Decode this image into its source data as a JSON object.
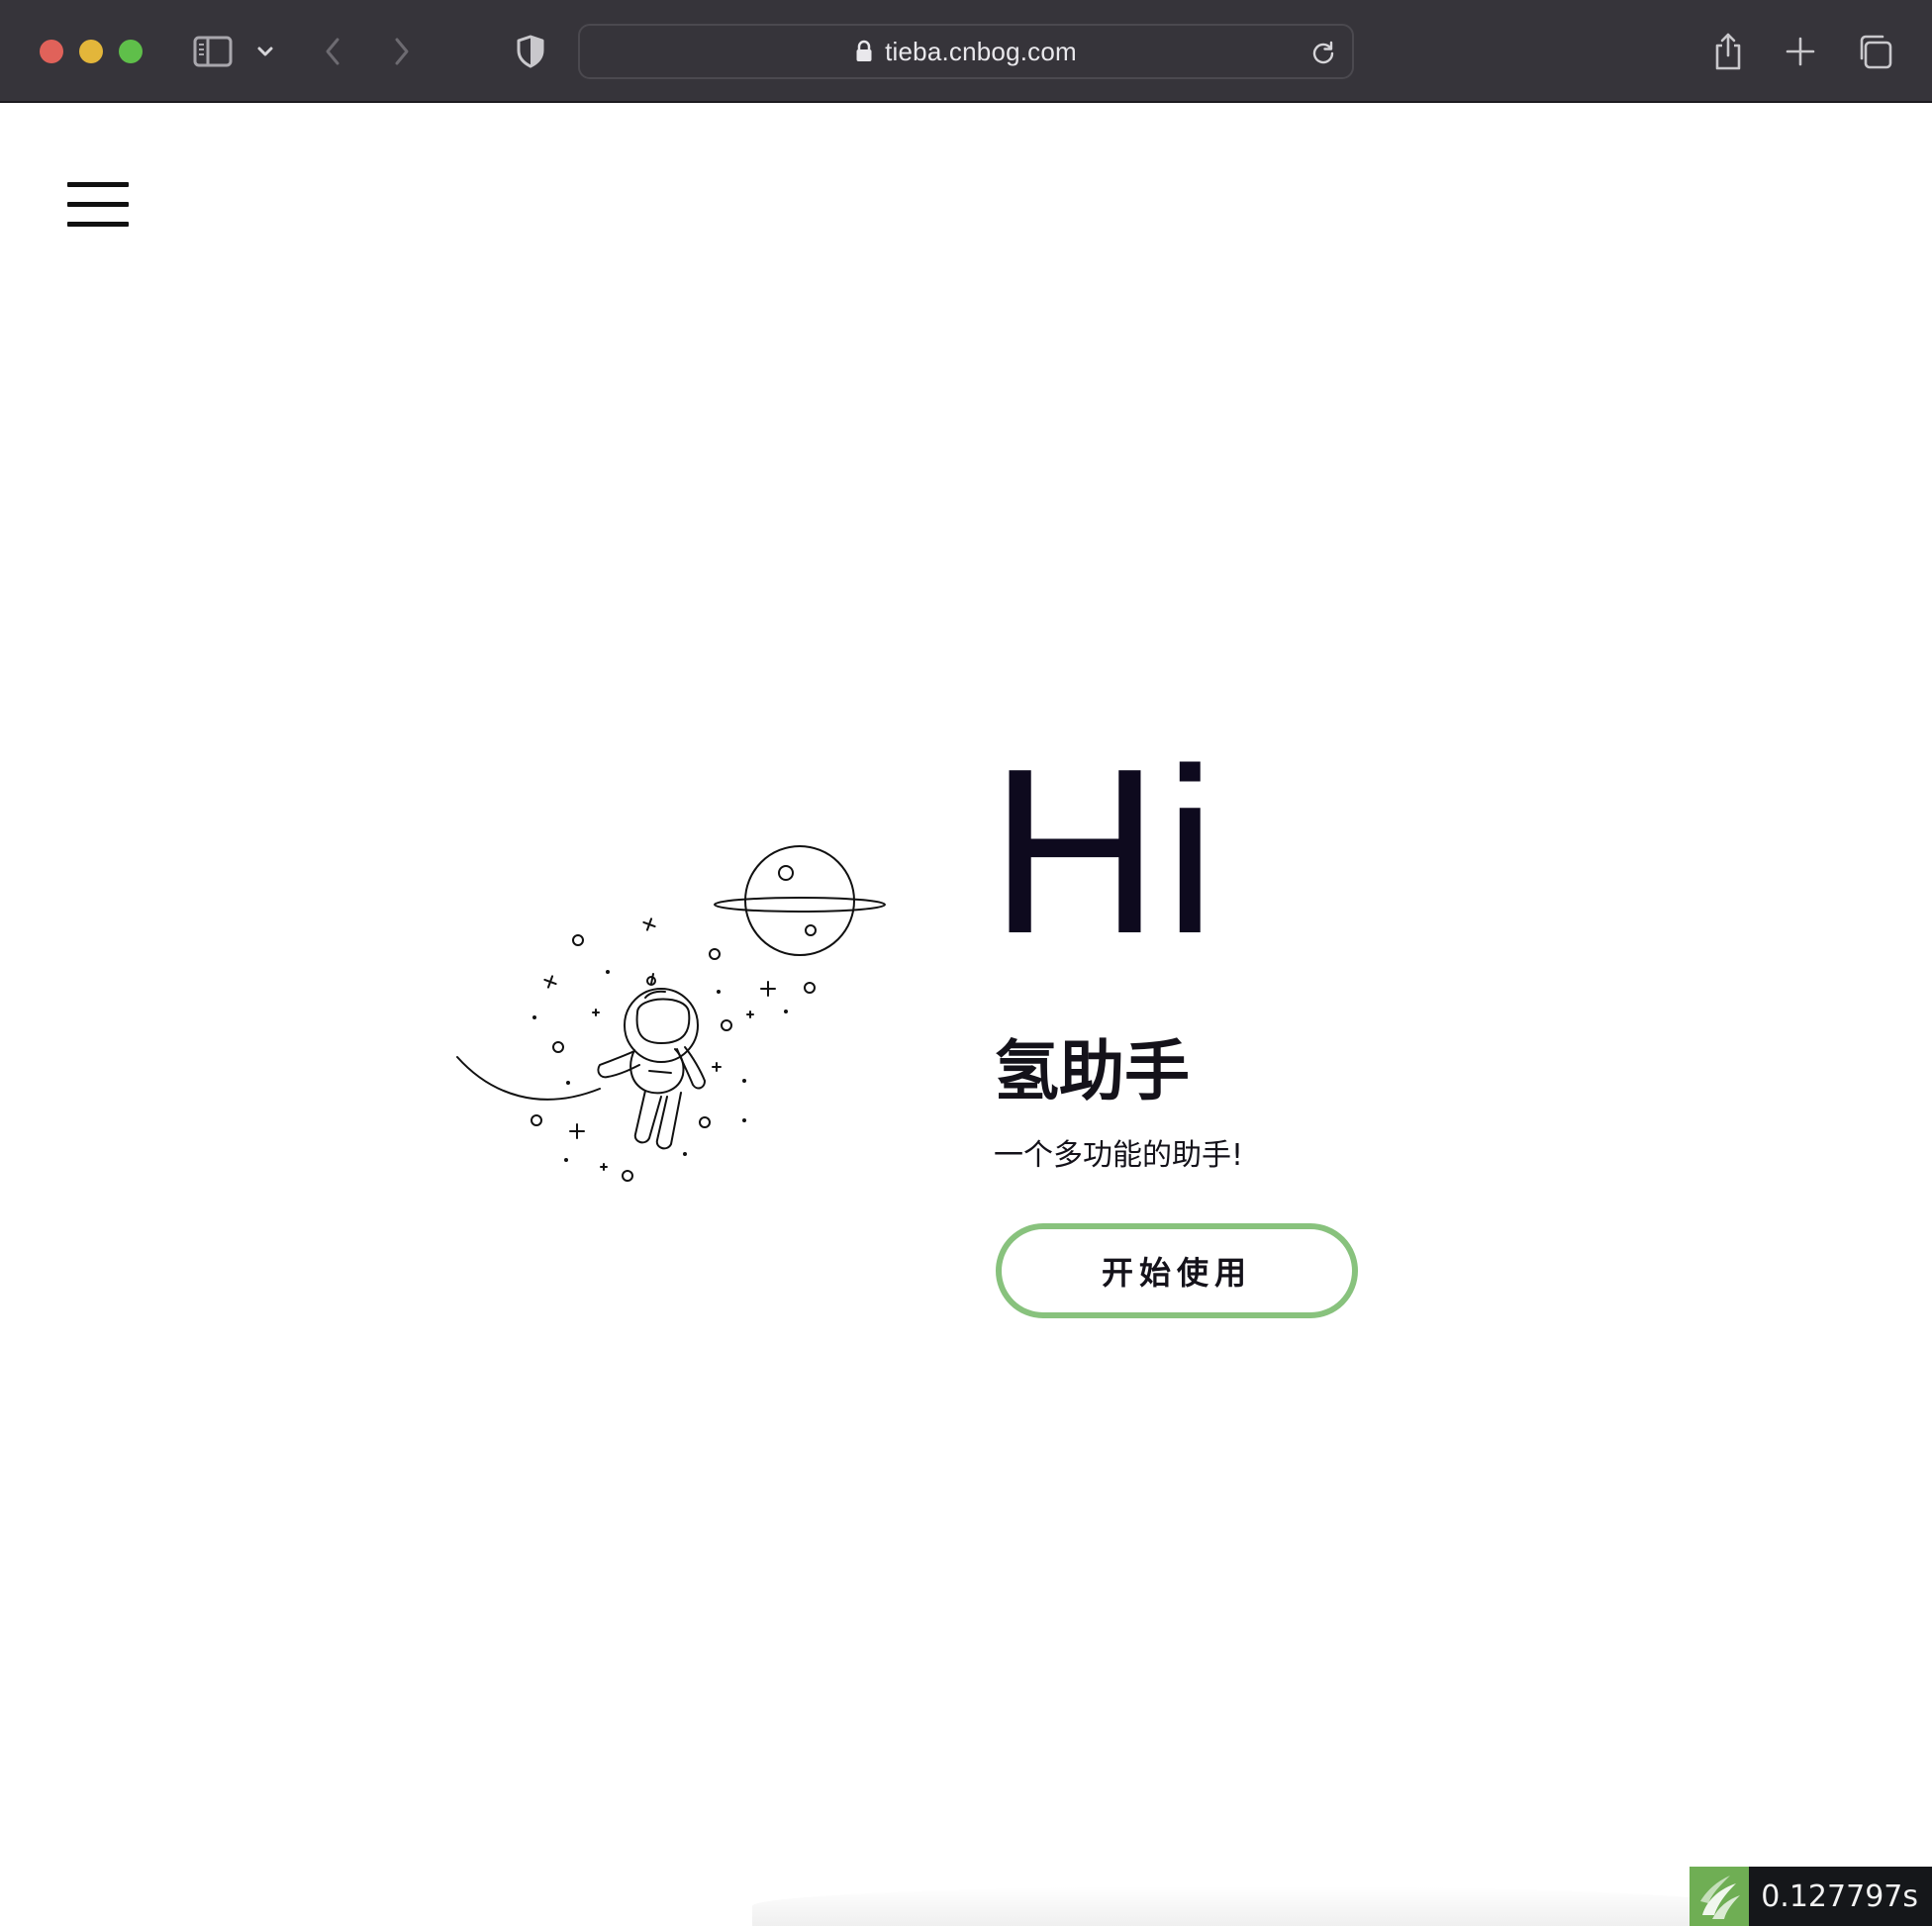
{
  "browser": {
    "url": "tieba.cnbog.com",
    "icons": {
      "sidebar": "sidebar-icon",
      "dropdown": "chevron-down-icon",
      "back": "chevron-left-icon",
      "forward": "chevron-right-icon",
      "privacy": "shield-icon",
      "lock": "lock-icon",
      "reload": "reload-icon",
      "share": "share-icon",
      "new_tab": "plus-icon",
      "tabs": "tabs-overview-icon"
    }
  },
  "page": {
    "menu_icon": "hamburger-icon",
    "illustration": "astronaut-planet-illustration",
    "hero": {
      "greeting": "Hi",
      "title": "氢助手",
      "subtitle": "一个多功能的助手!",
      "cta_label": "开始使用",
      "cta_border_color": "#88c27d"
    }
  },
  "widget": {
    "timer": "0.127797s",
    "logo_color": "#6fae54"
  }
}
